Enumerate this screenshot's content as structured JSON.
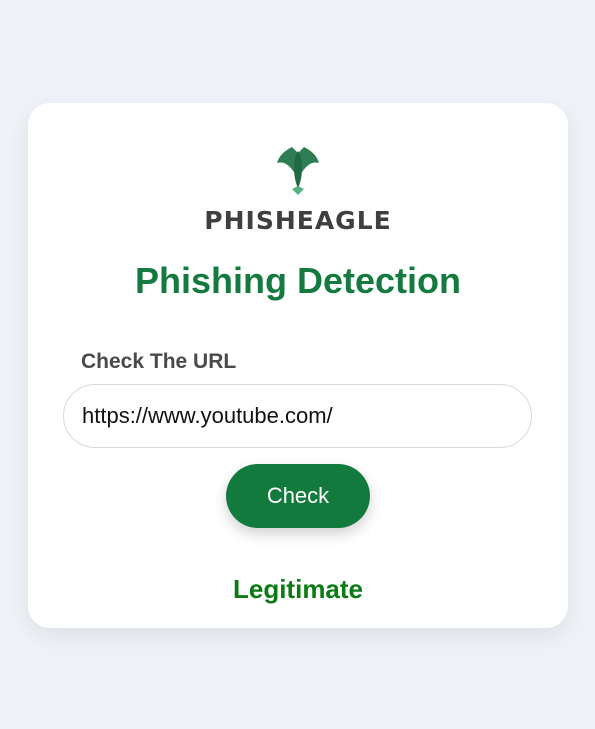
{
  "logo": {
    "icon": "eagle-icon",
    "brand_text": "PHISHEAGLE"
  },
  "header": {
    "title": "Phishing Detection"
  },
  "form": {
    "label": "Check The URL",
    "url_value": "https://www.youtube.com/",
    "button_label": "Check"
  },
  "result": {
    "text": "Legitimate",
    "color": "#0b7a13"
  },
  "colors": {
    "accent": "#157a3f",
    "button": "#127a3d",
    "background": "#eff2f7"
  }
}
